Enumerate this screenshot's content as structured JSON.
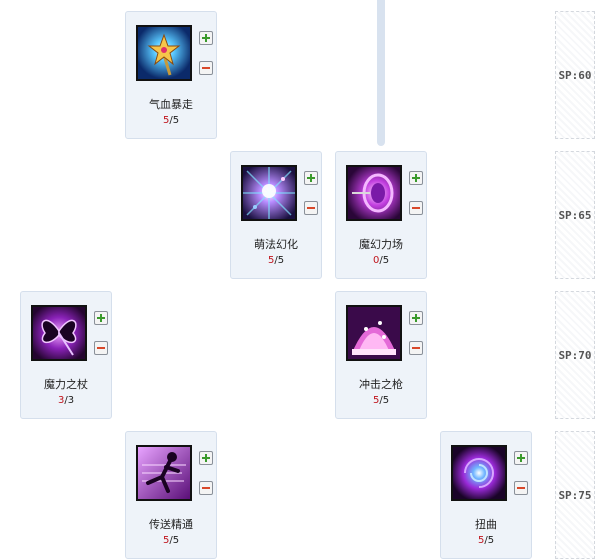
{
  "skills": [
    {
      "id": "qixue-baozou",
      "name": "气血暴走",
      "current": "5",
      "max": "5",
      "icon": "star-wand-icon"
    },
    {
      "id": "mengfa-huanhua",
      "name": "萌法幻化",
      "current": "5",
      "max": "5",
      "icon": "fairy-sparkle-icon"
    },
    {
      "id": "mohuan-lichang",
      "name": "魔幻力场",
      "current": "0",
      "max": "5",
      "icon": "magic-orb-icon"
    },
    {
      "id": "moli-zhizhang",
      "name": "魔力之杖",
      "current": "3",
      "max": "3",
      "icon": "butterfly-staff-icon"
    },
    {
      "id": "chongji-zhiqiang",
      "name": "冲击之枪",
      "current": "5",
      "max": "5",
      "icon": "pink-dome-icon"
    },
    {
      "id": "chuansong-jingtong",
      "name": "传送精通",
      "current": "5",
      "max": "5",
      "icon": "teleport-silhouette-icon"
    },
    {
      "id": "niuqu",
      "name": "扭曲",
      "current": "5",
      "max": "5",
      "icon": "vortex-icon"
    }
  ],
  "sp_labels": [
    "SP:60",
    "SP:65",
    "SP:70",
    "SP:75"
  ],
  "colors": {
    "card_bg": "#eef3f9",
    "card_border": "#d5dfec",
    "level_current": "#c0141c",
    "plus_button": "#3a9a2c",
    "minus_button": "#d9482a",
    "connector": "#d8e2ef"
  }
}
